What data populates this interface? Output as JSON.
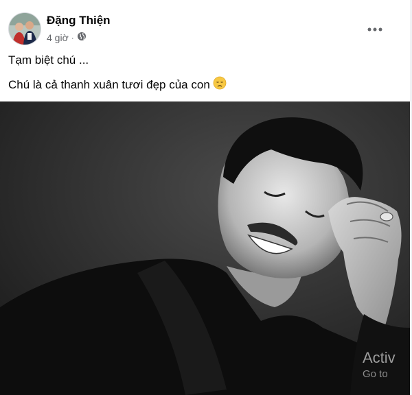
{
  "post": {
    "author": "Đặng Thiện",
    "time": "4 giờ",
    "separator": "·",
    "privacy_icon": "globe-icon",
    "more_icon": "more-options-icon",
    "lines": [
      "Tạm biệt chú ...",
      "Chú là cả thanh xuân tươi đẹp của con"
    ],
    "emoji": "disappointed-face-emoji",
    "photo_icon": "portrait-photo"
  },
  "overlay": {
    "line1": "Activ",
    "line2": "Go to"
  }
}
